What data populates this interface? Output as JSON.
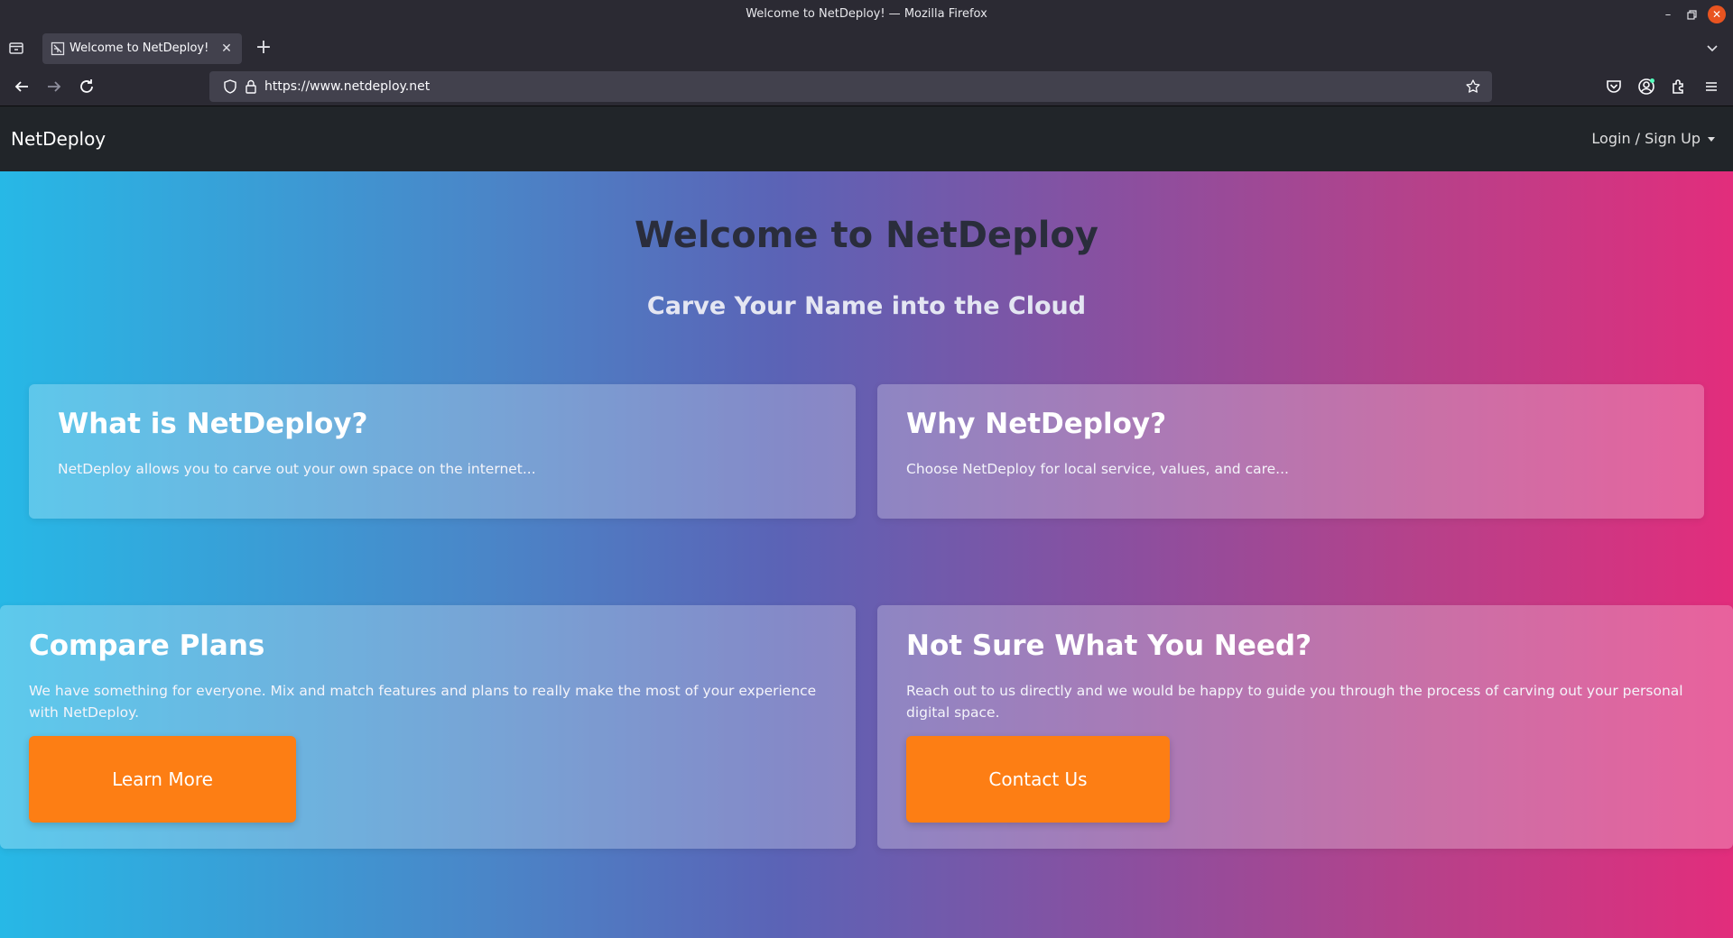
{
  "window": {
    "title": "Welcome to NetDeploy! — Mozilla Firefox"
  },
  "browser": {
    "tab": {
      "title": "Welcome to NetDeploy!",
      "close_glyph": "✕"
    },
    "new_tab_glyph": "+",
    "url": "https://www.netdeploy.net"
  },
  "site": {
    "brand": "NetDeploy",
    "login_label": "Login / Sign Up"
  },
  "hero": {
    "title": "Welcome to NetDeploy",
    "subtitle": "Carve Your Name into the Cloud"
  },
  "cards": [
    {
      "title": "What is NetDeploy?",
      "text": "NetDeploy allows you to carve out your own space on the internet..."
    },
    {
      "title": "Why NetDeploy?",
      "text": "Choose NetDeploy for local service, values, and care..."
    },
    {
      "title": "Compare Plans",
      "text": "We have something for everyone. Mix and match features and plans to really make the most of your experience with NetDeploy.",
      "button": "Learn More"
    },
    {
      "title": "Not Sure What You Need?",
      "text": "Reach out to us directly and we would be happy to guide you through the process of carving out your personal digital space.",
      "button": "Contact Us"
    }
  ],
  "colors": {
    "navbar_bg": "#212529",
    "cta_orange": "#fd7e14",
    "gradient_start": "#27b8e6",
    "gradient_end": "#e22d7c"
  }
}
